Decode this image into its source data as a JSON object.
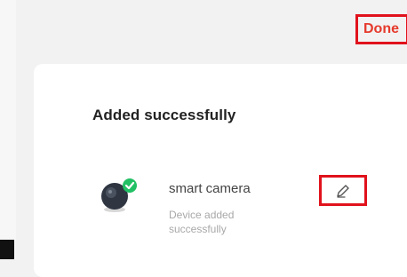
{
  "header": {
    "done_label": "Done"
  },
  "card": {
    "title": "Added successfully",
    "device": {
      "name": "smart camera",
      "status": "Device added successfully",
      "icon": "smart-camera-icon",
      "badge_icon": "check-badge-icon"
    },
    "edit_icon": "pencil-icon"
  },
  "colors": {
    "accent": "#e53a2c",
    "highlight_box": "#e0121c",
    "success_badge": "#21c064",
    "card_bg": "#ffffff",
    "page_bg": "#f2f2f2"
  }
}
